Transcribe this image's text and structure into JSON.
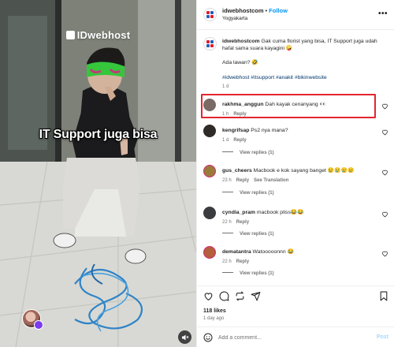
{
  "media": {
    "watermark": "IDwebhost",
    "overlay_caption": "IT Support juga bisa"
  },
  "header": {
    "username": "idwebhostcom",
    "separator": "•",
    "follow_label": "Follow",
    "location": "Yogyakarta"
  },
  "caption": {
    "username": "idwebhostcom",
    "text": "Gak cuma florist yang bisa, IT Support juga udah hafal sama suara kayagini 🤪",
    "text2": "Ada lawan? 🤣",
    "hashtags": "#idwebhost #itsupport #anakit #bikinwebsite",
    "time": "1 d"
  },
  "comments": [
    {
      "username": "rakhma_anggun",
      "text": "Dah kayak cenanyang 👀",
      "time": "1 h",
      "reply": "Reply",
      "avatar_color": "#7a6a66"
    },
    {
      "username": "kengrifsap",
      "text": "Ps2 nya mana?",
      "time": "1 d",
      "reply": "Reply",
      "view_replies": "View replies (1)",
      "avatar_color": "#2f2b29"
    },
    {
      "username": "gus_cheers",
      "text": "Macbook e kok sayang banget 😢😢😢😢",
      "time": "23 h",
      "reply": "Reply",
      "translation": "See Translation",
      "view_replies": "View replies (1)",
      "avatar_color": "#9a7b3c"
    },
    {
      "username": "cyndia_pram",
      "text": "macbook pliss😂😂",
      "time": "22 h",
      "reply": "Reply",
      "view_replies": "View replies (1)",
      "avatar_color": "#3a3b3f"
    },
    {
      "username": "dematantra",
      "text": "Watooooonnn 😂",
      "time": "22 h",
      "reply": "Reply",
      "view_replies": "View replies (1)",
      "avatar_color": "#b35e3c"
    }
  ],
  "engagement": {
    "likes": "118 likes",
    "date": "1 day ago"
  },
  "add_comment": {
    "placeholder": "Add a comment...",
    "post_label": "Post"
  },
  "colors": {
    "follow": "#0095f6",
    "highlight": "#e2262d",
    "hashtag": "#00376b"
  }
}
